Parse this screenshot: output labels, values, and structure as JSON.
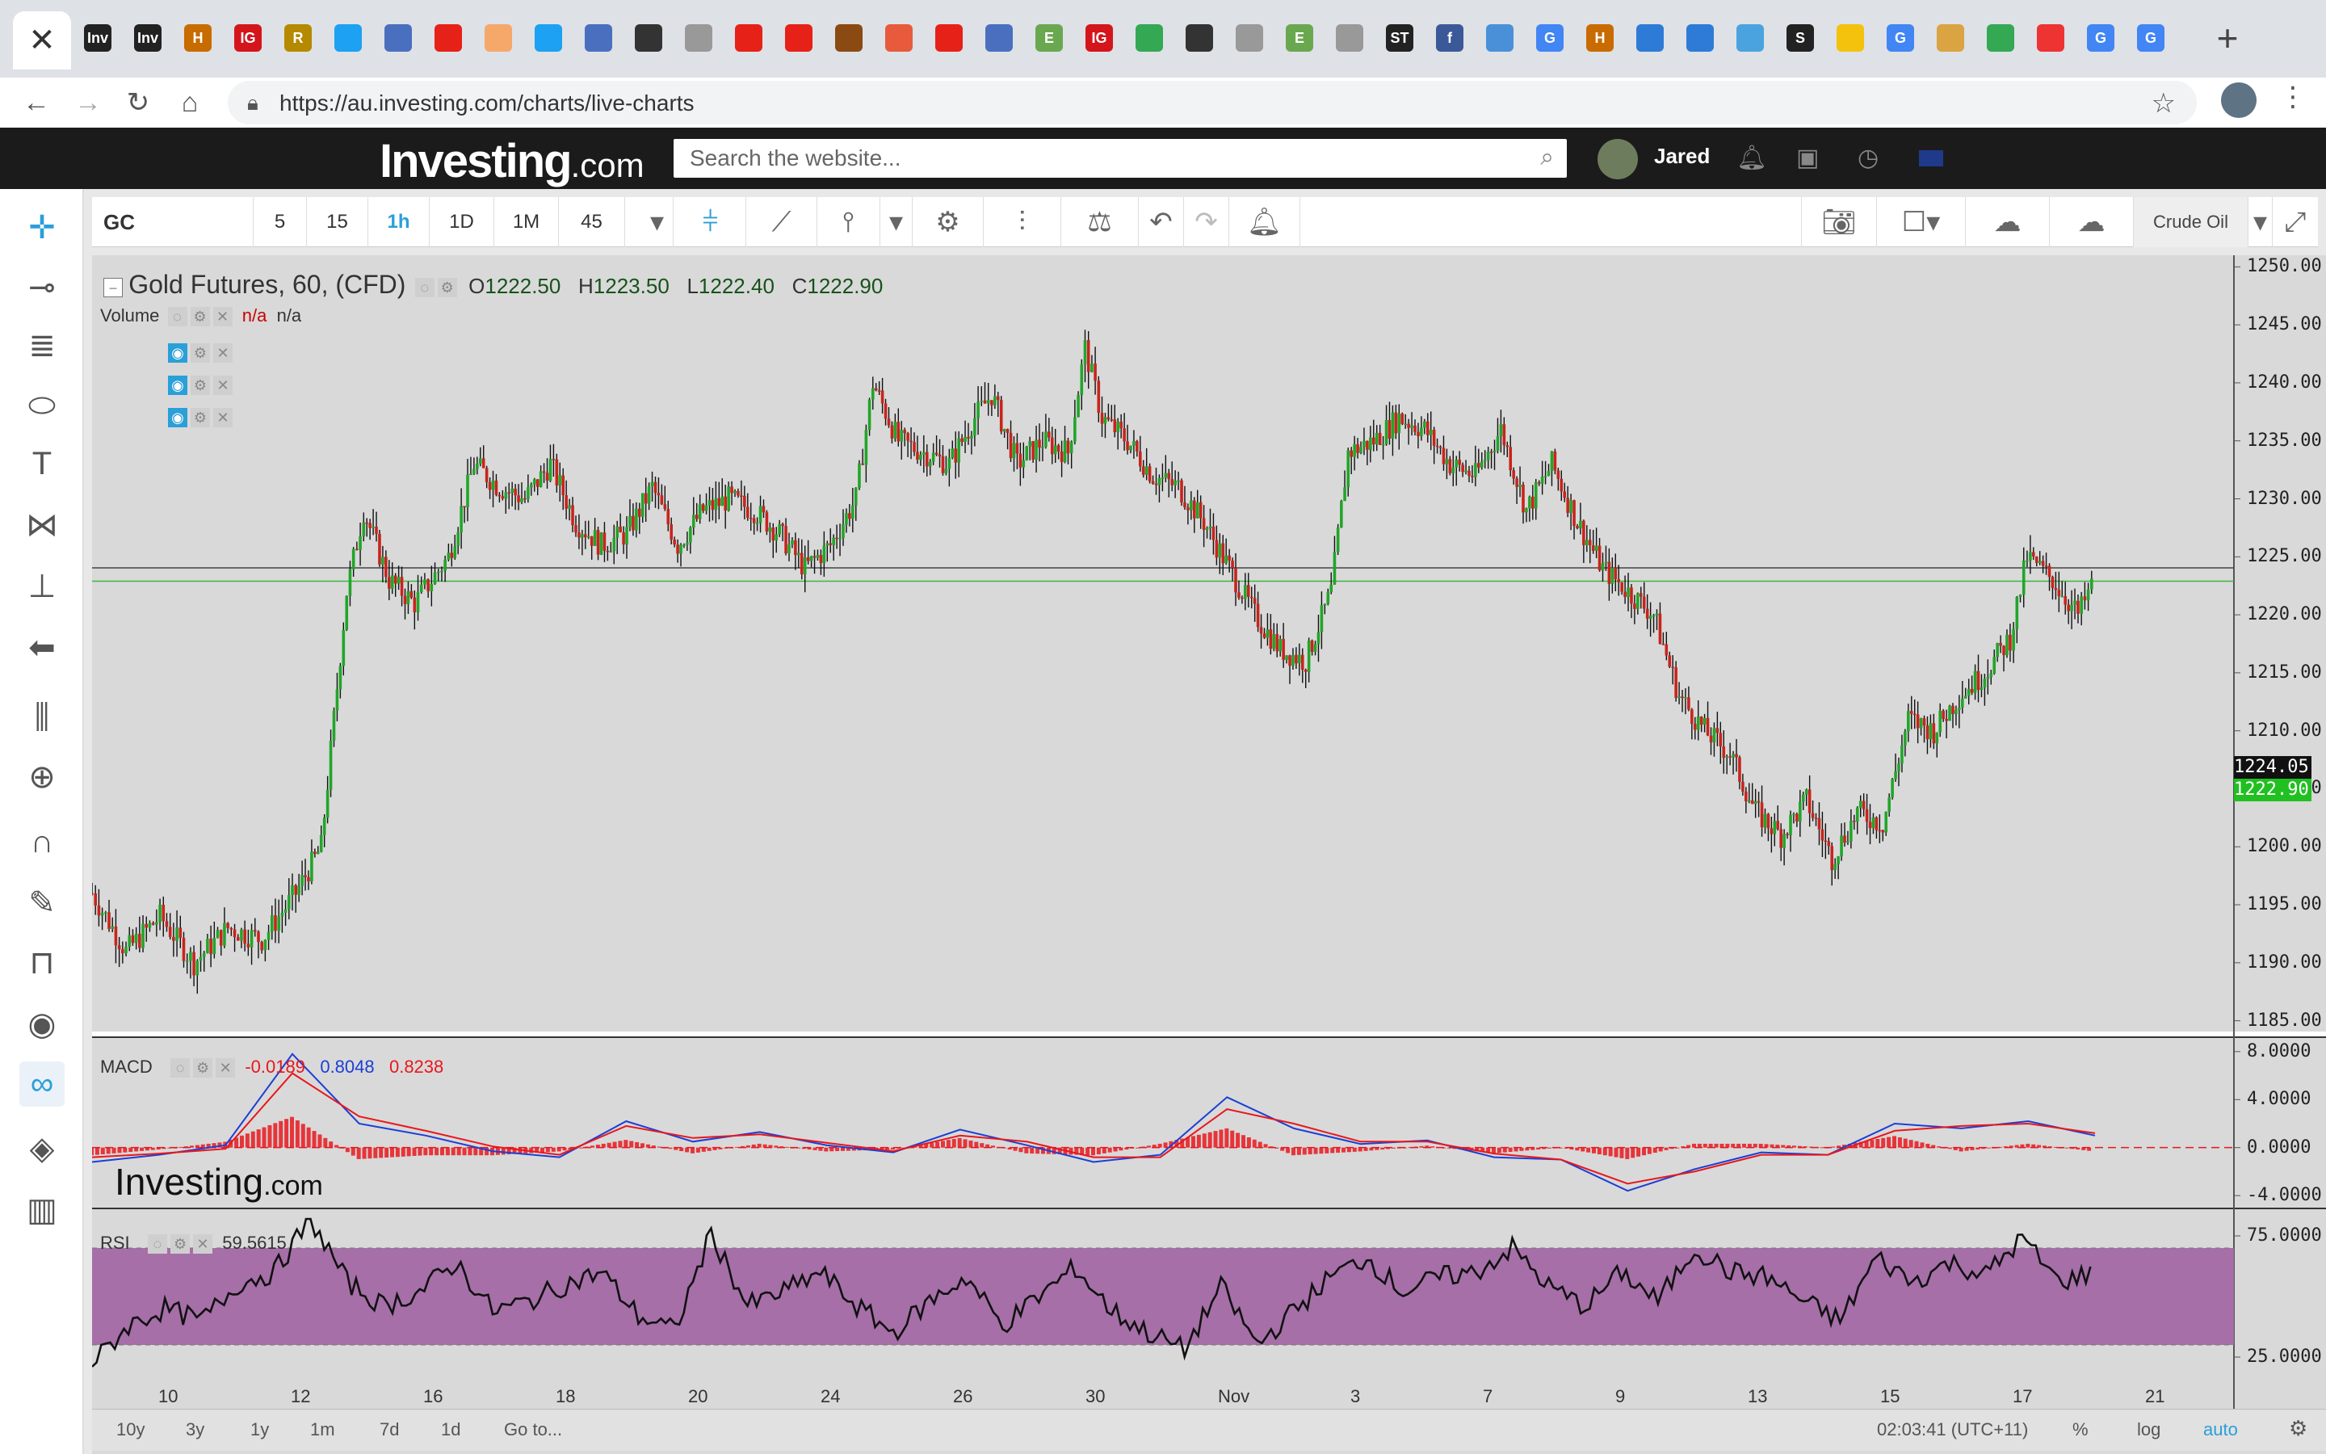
{
  "browser": {
    "close_tab": "✕",
    "new_tab": "+",
    "url": "https://au.investing.com/charts/live-charts",
    "favicons": [
      {
        "icon": "inv-icon",
        "label": "Inv",
        "color": "#222"
      },
      {
        "icon": "inv-icon",
        "label": "Inv",
        "color": "#222"
      },
      {
        "icon": "h-icon",
        "label": "H",
        "color": "#c86b00"
      },
      {
        "icon": "ig-icon",
        "label": "IG",
        "color": "#d4151c"
      },
      {
        "icon": "r-icon",
        "label": "R",
        "color": "#b58900"
      },
      {
        "icon": "twitter-icon",
        "label": "",
        "color": "#1da1f2"
      },
      {
        "icon": "globe-icon",
        "label": "",
        "color": "#4a6fbf"
      },
      {
        "icon": "youtube-icon",
        "label": "",
        "color": "#e62117"
      },
      {
        "icon": "orange-icon",
        "label": "",
        "color": "#f6a86b"
      },
      {
        "icon": "twitter-icon",
        "label": "",
        "color": "#1da1f2"
      },
      {
        "icon": "globe-icon",
        "label": "",
        "color": "#4a6fbf"
      },
      {
        "icon": "bars-icon",
        "label": "",
        "color": "#333"
      },
      {
        "icon": "doc-icon",
        "label": "",
        "color": "#999"
      },
      {
        "icon": "youtube-icon",
        "label": "",
        "color": "#e62117"
      },
      {
        "icon": "youtube-icon",
        "label": "",
        "color": "#e62117"
      },
      {
        "icon": "fx-icon",
        "label": "",
        "color": "#8b4a12"
      },
      {
        "icon": "target-icon",
        "label": "",
        "color": "#e85a3c"
      },
      {
        "icon": "youtube-icon",
        "label": "",
        "color": "#e62117"
      },
      {
        "icon": "globe-icon",
        "label": "",
        "color": "#4a6fbf"
      },
      {
        "icon": "e-icon",
        "label": "E",
        "color": "#6aa84f"
      },
      {
        "icon": "ig-icon",
        "label": "IG",
        "color": "#d4151c"
      },
      {
        "icon": "maps-icon",
        "label": "",
        "color": "#34a853"
      },
      {
        "icon": "search-icon",
        "label": "",
        "color": "#333"
      },
      {
        "icon": "doc-icon",
        "label": "",
        "color": "#999"
      },
      {
        "icon": "e-icon",
        "label": "E",
        "color": "#6aa84f"
      },
      {
        "icon": "doc-icon",
        "label": "",
        "color": "#999"
      },
      {
        "icon": "st-icon",
        "label": "ST",
        "color": "#222"
      },
      {
        "icon": "facebook-icon",
        "label": "f",
        "color": "#3b5998"
      },
      {
        "icon": "chart-icon",
        "label": "",
        "color": "#4a90d9"
      },
      {
        "icon": "google-icon",
        "label": "G",
        "color": "#4285f4"
      },
      {
        "icon": "h-icon",
        "label": "H",
        "color": "#c86b00"
      },
      {
        "icon": "bracket-icon",
        "label": "",
        "color": "#2d7bd6"
      },
      {
        "icon": "bracket-icon",
        "label": "",
        "color": "#2d7bd6"
      },
      {
        "icon": "cloud-icon",
        "label": "",
        "color": "#4aa3df"
      },
      {
        "icon": "s-icon",
        "label": "S",
        "color": "#222"
      },
      {
        "icon": "pen-icon",
        "label": "",
        "color": "#f4c20d"
      },
      {
        "icon": "google-icon",
        "label": "G",
        "color": "#4285f4"
      },
      {
        "icon": "face-icon",
        "label": "",
        "color": "#d9a441"
      },
      {
        "icon": "maps-icon",
        "label": "",
        "color": "#34a853"
      },
      {
        "icon": "swoosh-icon",
        "label": "",
        "color": "#e33"
      },
      {
        "icon": "google-icon",
        "label": "G",
        "color": "#4285f4"
      },
      {
        "icon": "google-icon",
        "label": "G",
        "color": "#4285f4"
      }
    ]
  },
  "site": {
    "logo_main": "Investing",
    "logo_suffix": ".com",
    "search_placeholder": "Search the website...",
    "username": "Jared"
  },
  "toolbar": {
    "symbol": "GC",
    "intervals": [
      "5",
      "15",
      "1h",
      "1D",
      "1M",
      "45"
    ],
    "active_interval": "1h",
    "compare_label": "Crude Oil"
  },
  "legend": {
    "title": "Gold Futures, 60, (CFD)",
    "o_label": "O",
    "o_value": "1222.50",
    "h_label": "H",
    "h_value": "1223.50",
    "l_label": "L",
    "l_value": "1222.40",
    "c_label": "C",
    "c_value": "1222.90",
    "volume_label": "Volume",
    "volume_val1": "n/a",
    "volume_val2": "n/a",
    "macd_label": "MACD",
    "macd_hist": "-0.0189",
    "macd_line": "0.8048",
    "macd_signal": "0.8238",
    "rsi_label": "RSI",
    "rsi_value": "59.5615"
  },
  "price_tags": {
    "last": "1224.05",
    "close": "1222.90"
  },
  "watermark": {
    "main": "Investing",
    "suffix": ".com"
  },
  "bottom": {
    "ranges": [
      "10y",
      "3y",
      "1y",
      "1m",
      "7d",
      "1d"
    ],
    "goto": "Go to...",
    "time": "02:03:41 (UTC+11)",
    "pct": "%",
    "log": "log",
    "auto": "auto"
  },
  "chart_data": [
    {
      "type": "candlestick",
      "title": "Gold Futures, 60, (CFD)",
      "y_ticks": [
        "1250.00",
        "1245.00",
        "1240.00",
        "1235.00",
        "1230.00",
        "1225.00",
        "1220.00",
        "1215.00",
        "1210.00",
        "1205.00",
        "1200.00",
        "1195.00",
        "1190.00",
        "1185.00"
      ],
      "ylim": [
        1184,
        1251
      ],
      "x_ticks": [
        "10",
        "12",
        "16",
        "18",
        "20",
        "24",
        "26",
        "30",
        "Nov",
        "3",
        "7",
        "9",
        "13",
        "15",
        "17",
        "21"
      ],
      "path_points": [
        [
          0,
          1196
        ],
        [
          20,
          1191
        ],
        [
          40,
          1194
        ],
        [
          60,
          1190
        ],
        [
          80,
          1193
        ],
        [
          100,
          1192
        ],
        [
          120,
          1196
        ],
        [
          135,
          1200
        ],
        [
          150,
          1222
        ],
        [
          160,
          1229
        ],
        [
          175,
          1223
        ],
        [
          190,
          1221
        ],
        [
          210,
          1225
        ],
        [
          225,
          1233
        ],
        [
          240,
          1231
        ],
        [
          255,
          1230
        ],
        [
          270,
          1233
        ],
        [
          285,
          1228
        ],
        [
          300,
          1226
        ],
        [
          315,
          1227
        ],
        [
          330,
          1231
        ],
        [
          345,
          1226
        ],
        [
          360,
          1229
        ],
        [
          375,
          1230
        ],
        [
          390,
          1229
        ],
        [
          405,
          1227
        ],
        [
          420,
          1224
        ],
        [
          435,
          1226
        ],
        [
          450,
          1230
        ],
        [
          460,
          1240
        ],
        [
          475,
          1235
        ],
        [
          490,
          1234
        ],
        [
          505,
          1233
        ],
        [
          520,
          1237
        ],
        [
          530,
          1239
        ],
        [
          545,
          1233
        ],
        [
          560,
          1235
        ],
        [
          575,
          1234
        ],
        [
          585,
          1243
        ],
        [
          595,
          1237
        ],
        [
          610,
          1235
        ],
        [
          625,
          1232
        ],
        [
          640,
          1231
        ],
        [
          655,
          1228
        ],
        [
          670,
          1224
        ],
        [
          685,
          1220
        ],
        [
          700,
          1217
        ],
        [
          715,
          1216
        ],
        [
          730,
          1222
        ],
        [
          740,
          1234
        ],
        [
          755,
          1235
        ],
        [
          770,
          1237
        ],
        [
          785,
          1236
        ],
        [
          800,
          1233
        ],
        [
          815,
          1232
        ],
        [
          830,
          1236
        ],
        [
          845,
          1229
        ],
        [
          860,
          1233
        ],
        [
          875,
          1228
        ],
        [
          890,
          1224
        ],
        [
          905,
          1222
        ],
        [
          920,
          1220
        ],
        [
          935,
          1213
        ],
        [
          950,
          1210
        ],
        [
          965,
          1208
        ],
        [
          980,
          1203
        ],
        [
          995,
          1201
        ],
        [
          1010,
          1204
        ],
        [
          1025,
          1199
        ],
        [
          1040,
          1203
        ],
        [
          1055,
          1202
        ],
        [
          1070,
          1211
        ],
        [
          1085,
          1210
        ],
        [
          1100,
          1213
        ],
        [
          1115,
          1215
        ],
        [
          1130,
          1218
        ],
        [
          1140,
          1225
        ],
        [
          1155,
          1223
        ],
        [
          1170,
          1220
        ],
        [
          1180,
          1223
        ]
      ]
    },
    {
      "type": "line",
      "title": "MACD",
      "y_ticks": [
        "8.0000",
        "4.0000",
        "0.0000",
        "-4.0000"
      ],
      "ylim": [
        -4.8,
        9.2
      ],
      "series": [
        {
          "name": "MACD",
          "color": "#1a3fd6",
          "values": [
            -1.2,
            -0.6,
            0.2,
            7.8,
            2.0,
            1.0,
            -0.3,
            -0.8,
            2.2,
            0.5,
            1.3,
            0.2,
            -0.4,
            1.5,
            0.2,
            -1.2,
            -0.6,
            4.2,
            1.6,
            0.3,
            0.6,
            -0.8,
            -1.0,
            -3.6,
            -1.8,
            -0.4,
            -0.6,
            2.0,
            1.6,
            2.2,
            1.0
          ]
        },
        {
          "name": "Signal",
          "color": "#e8171d",
          "values": [
            -0.8,
            -0.5,
            -0.1,
            6.2,
            2.6,
            1.4,
            0.1,
            -0.6,
            1.8,
            0.8,
            1.1,
            0.4,
            -0.3,
            1.0,
            0.5,
            -0.8,
            -0.8,
            3.2,
            2.0,
            0.5,
            0.5,
            -0.5,
            -1.0,
            -3.0,
            -2.0,
            -0.6,
            -0.6,
            1.4,
            1.8,
            2.0,
            1.2
          ]
        }
      ],
      "histogram_color": "#e8171d"
    },
    {
      "type": "line",
      "title": "RSI",
      "y_ticks": [
        "75.0000",
        "25.0000"
      ],
      "ylim": [
        15,
        85
      ],
      "band": [
        30,
        70
      ],
      "series": [
        {
          "name": "RSI",
          "color": "#111",
          "values": [
            22,
            38,
            45,
            40,
            55,
            60,
            82,
            56,
            46,
            52,
            64,
            44,
            48,
            55,
            60,
            42,
            36,
            76,
            46,
            52,
            60,
            46,
            35,
            48,
            58,
            38,
            50,
            62,
            44,
            35,
            28,
            54,
            30,
            44,
            58,
            66,
            52,
            58,
            60,
            70,
            54,
            46,
            60,
            48,
            70,
            60,
            58,
            48,
            40,
            66,
            56,
            64,
            59,
            74,
            56,
            60
          ]
        }
      ]
    }
  ]
}
